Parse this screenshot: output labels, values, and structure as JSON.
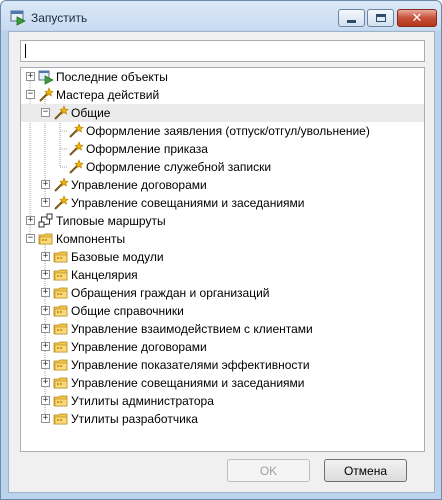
{
  "window": {
    "title": "Запустить",
    "title_icon": "run-arrow-icon",
    "controls": {
      "minimize_icon": "minimize-icon",
      "maximize_icon": "maximize-icon",
      "close_icon": "close-icon",
      "close_glyph": "✕"
    }
  },
  "search": {
    "value": "",
    "placeholder": ""
  },
  "tree": {
    "nodes": [
      {
        "label": "Последние объекты",
        "icon": "recent-objects-icon",
        "expander": "+"
      },
      {
        "label": "Мастера действий",
        "icon": "wizard-icon",
        "expander": "−"
      },
      {
        "label": "Общие",
        "icon": "wizard-icon",
        "expander": "−"
      },
      {
        "label": "Оформление заявления (отпуск/отгул/увольнение)",
        "icon": "wizard-icon",
        "expander": ""
      },
      {
        "label": "Оформление приказа",
        "icon": "wizard-icon",
        "expander": ""
      },
      {
        "label": "Оформление служебной записки",
        "icon": "wizard-icon",
        "expander": ""
      },
      {
        "label": "Управление договорами",
        "icon": "wizard-icon",
        "expander": "+"
      },
      {
        "label": "Управление совещаниями и заседаниями",
        "icon": "wizard-icon",
        "expander": "+"
      },
      {
        "label": "Типовые маршруты",
        "icon": "route-icon",
        "expander": "+"
      },
      {
        "label": "Компоненты",
        "icon": "folder-icon",
        "expander": "−"
      },
      {
        "label": "Базовые модули",
        "icon": "folder-icon",
        "expander": "+"
      },
      {
        "label": "Канцелярия",
        "icon": "folder-icon",
        "expander": "+"
      },
      {
        "label": "Обращения граждан и организаций",
        "icon": "folder-icon",
        "expander": "+"
      },
      {
        "label": "Общие справочники",
        "icon": "folder-icon",
        "expander": "+"
      },
      {
        "label": "Управление взаимодействием с клиентами",
        "icon": "folder-icon",
        "expander": "+"
      },
      {
        "label": "Управление договорами",
        "icon": "folder-icon",
        "expander": "+"
      },
      {
        "label": "Управление показателями эффективности",
        "icon": "folder-icon",
        "expander": "+"
      },
      {
        "label": "Управление совещаниями и заседаниями",
        "icon": "folder-icon",
        "expander": "+"
      },
      {
        "label": "Утилиты администратора",
        "icon": "folder-icon",
        "expander": "+"
      },
      {
        "label": "Утилиты разработчика",
        "icon": "folder-icon",
        "expander": "+"
      }
    ]
  },
  "buttons": {
    "ok": "OK",
    "cancel": "Отмена"
  },
  "colors": {
    "selection": "#ebebeb",
    "wizard_star": "#f0b400",
    "folder": "#f3c64a",
    "run_arrow": "#3aa13a"
  }
}
